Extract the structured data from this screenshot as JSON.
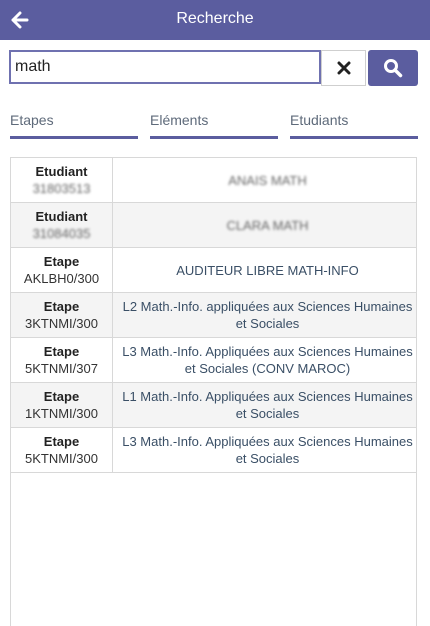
{
  "header": {
    "title": "Recherche",
    "back_icon": "arrow-left-icon"
  },
  "search": {
    "value": "math",
    "clear_icon": "close-icon",
    "submit_icon": "search-icon"
  },
  "tabs": [
    {
      "label": "Etapes"
    },
    {
      "label": "Eléments"
    },
    {
      "label": "Etudiants"
    }
  ],
  "results": [
    {
      "kind": "Etudiant",
      "code": "31803513",
      "label": [
        "ANAIS MATH"
      ],
      "blurred": true
    },
    {
      "kind": "Etudiant",
      "code": "31084035",
      "label": [
        "CLARA MATH"
      ],
      "blurred": true
    },
    {
      "kind": "Etape",
      "code": "AKLBH0/300",
      "label": [
        "AUDITEUR LIBRE MATH-INFO"
      ],
      "blurred": false
    },
    {
      "kind": "Etape",
      "code": "3KTNMI/300",
      "label": [
        "L2 Math.-Info. appliquées aux Sciences Humaines",
        "et Sociales"
      ],
      "blurred": false
    },
    {
      "kind": "Etape",
      "code": "5KTNMI/307",
      "label": [
        "L3 Math.-Info. Appliquées aux Sciences Humaines",
        "et Sociales (CONV MAROC)"
      ],
      "blurred": false
    },
    {
      "kind": "Etape",
      "code": "1KTNMI/300",
      "label": [
        "L1 Math.-Info. Appliquées aux Sciences Humaines",
        "et Sociales"
      ],
      "blurred": false
    },
    {
      "kind": "Etape",
      "code": "5KTNMI/300",
      "label": [
        "L3 Math.-Info. Appliquées aux Sciences Humaines",
        "et Sociales"
      ],
      "blurred": false
    }
  ],
  "colors": {
    "accent": "#5b5d9f",
    "link_text": "#3a4f66",
    "row_alt": "#f4f4f4",
    "border": "#d8d8d8"
  }
}
